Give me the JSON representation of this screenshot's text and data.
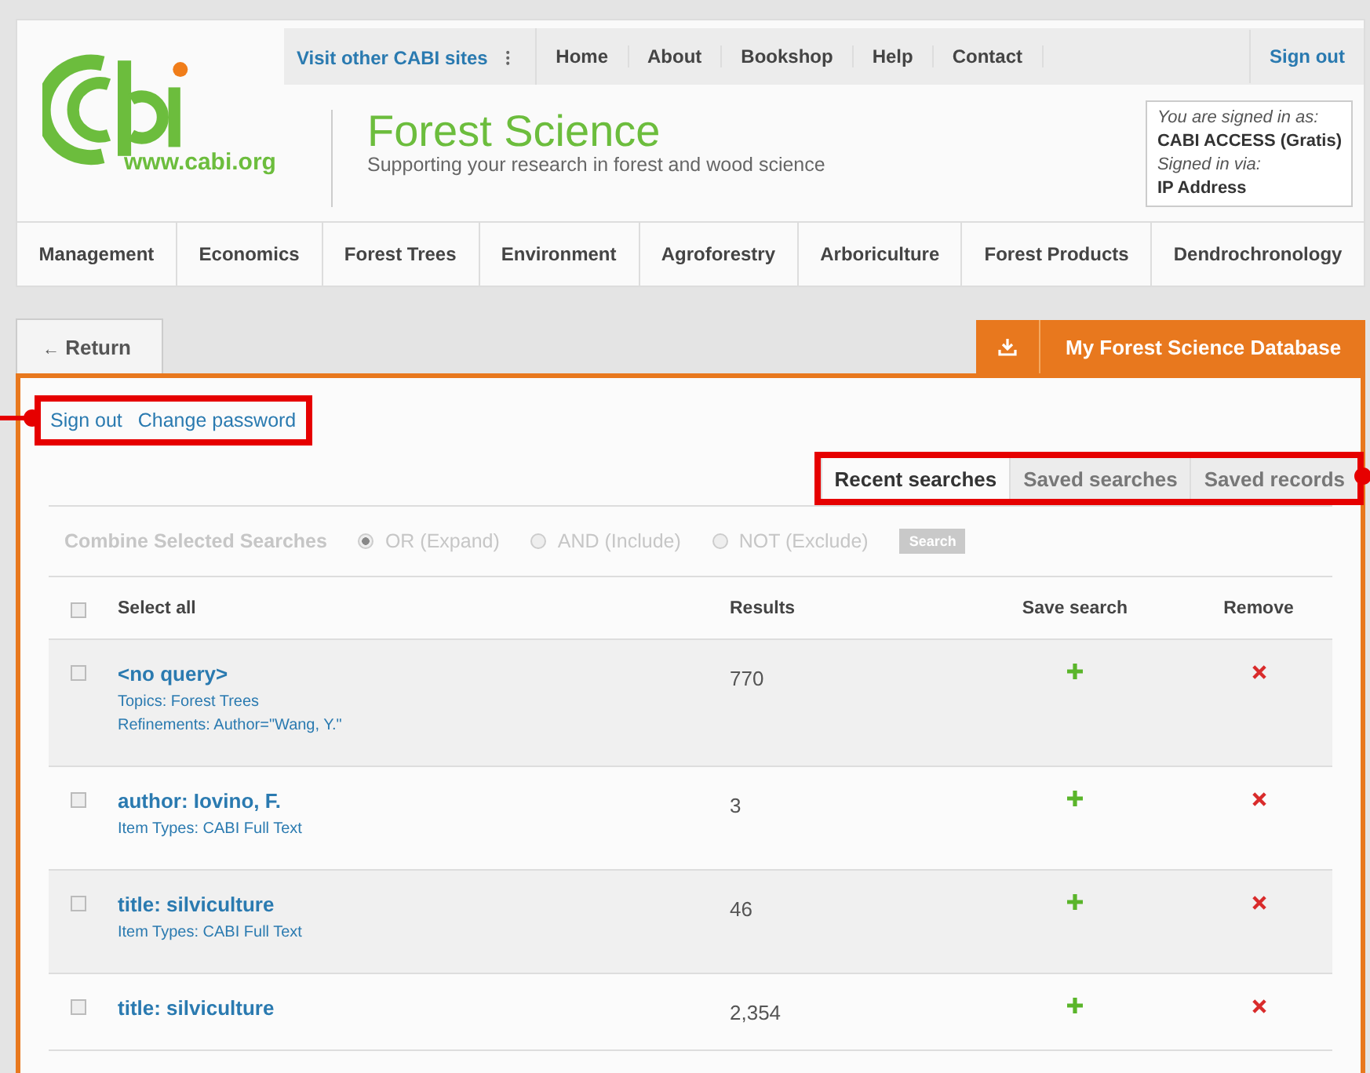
{
  "top_nav": {
    "sites_menu": "Visit other CABI sites",
    "menu_caret": "⁝",
    "links": [
      "Home",
      "About",
      "Bookshop",
      "Help",
      "Contact"
    ],
    "sign_out": "Sign out"
  },
  "logo": {
    "url": "www.cabi.org"
  },
  "site": {
    "title": "Forest Science",
    "subtitle": "Supporting your research in forest and wood science"
  },
  "account": {
    "signed_in_label": "You are signed in as:",
    "user": "CABI ACCESS (Gratis)",
    "via_label": "Signed in via:",
    "via": "IP Address"
  },
  "categories": [
    "Management",
    "Economics",
    "Forest Trees",
    "Environment",
    "Agroforestry",
    "Arboriculture",
    "Forest Products",
    "Dendrochronology"
  ],
  "return_tab": {
    "arrow": "←",
    "label": "Return"
  },
  "database_tab": {
    "label": "My Forest Science Database"
  },
  "account_links": [
    "Sign out",
    "Change password"
  ],
  "tabs": [
    {
      "label": "Recent searches",
      "selected": true
    },
    {
      "label": "Saved searches",
      "selected": false
    },
    {
      "label": "Saved records",
      "selected": false
    }
  ],
  "combine": {
    "label": "Combine Selected Searches",
    "disabled": true,
    "options": [
      {
        "label": "OR (Expand)",
        "selected": true
      },
      {
        "label": "AND (Include)",
        "selected": false
      },
      {
        "label": "NOT (Exclude)",
        "selected": false
      }
    ],
    "button": "Search"
  },
  "table": {
    "select_all_checked": false,
    "columns": [
      "Select all",
      "Results",
      "Save search",
      "Remove"
    ],
    "rows": [
      {
        "query": "<no query>",
        "details": [
          "Topics: Forest Trees",
          "Refinements: Author=\"Wang, Y.\""
        ],
        "results": "770",
        "checked": false
      },
      {
        "query": "author: Iovino, F.",
        "details": [
          "Item Types: CABI Full Text"
        ],
        "results": "3",
        "checked": false
      },
      {
        "query": "title: silviculture",
        "details": [
          "Item Types: CABI Full Text"
        ],
        "results": "46",
        "checked": false
      },
      {
        "query": "title: silviculture",
        "details": [],
        "results": "2,354",
        "checked": false
      }
    ]
  }
}
